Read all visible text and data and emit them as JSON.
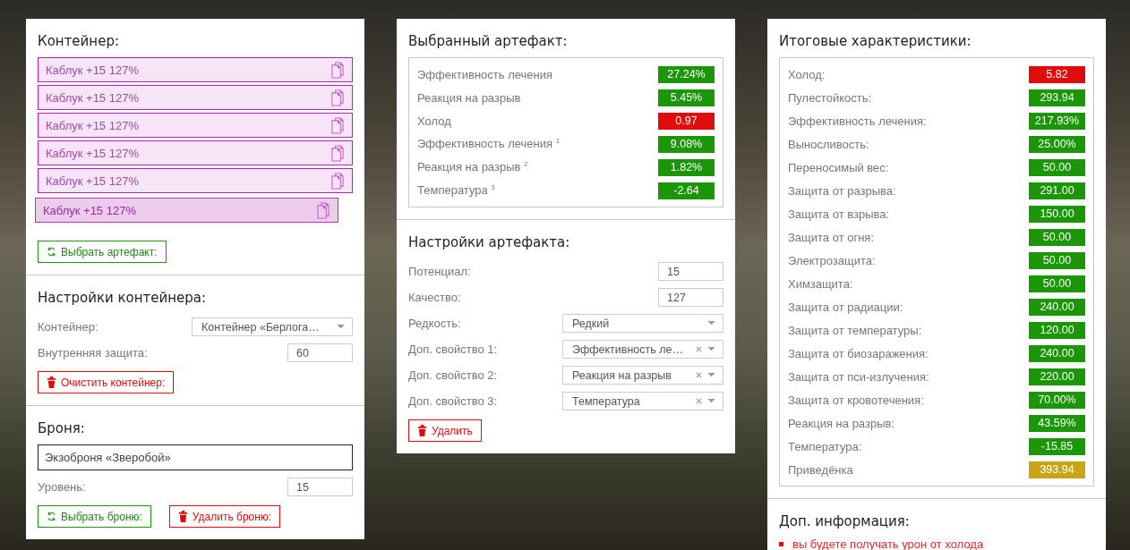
{
  "container": {
    "title": "Контейнер:",
    "items": [
      {
        "label": "Каблук +15 127%",
        "selected": false
      },
      {
        "label": "Каблук +15 127%",
        "selected": false
      },
      {
        "label": "Каблук +15 127%",
        "selected": false
      },
      {
        "label": "Каблук +15 127%",
        "selected": false
      },
      {
        "label": "Каблук +15 127%",
        "selected": false
      },
      {
        "label": "Каблук +15 127%",
        "selected": true
      }
    ],
    "select_button": "Выбрать артефакт:"
  },
  "container_settings": {
    "title": "Настройки контейнера:",
    "fields": [
      {
        "kind": "select",
        "label": "Контейнер:",
        "value": "Контейнер «Берлога…",
        "clearable": false
      },
      {
        "kind": "input",
        "label": "Внутренняя защита:",
        "value": "60"
      }
    ],
    "clear_button": "Очистить контейнер:"
  },
  "armor": {
    "title": "Броня:",
    "name": "Экзоброня «Зверобой»",
    "fields": [
      {
        "kind": "input",
        "label": "Уровень:",
        "value": "15"
      }
    ],
    "select_button": "Выбрать броню:",
    "delete_button": "Удалить броню:"
  },
  "selected_artifact": {
    "title": "Выбранный артефакт:",
    "stats": [
      {
        "label": "Эффективность лечения",
        "value": "27.24%",
        "color": "#1a9606"
      },
      {
        "label": "Реакция на разрыв",
        "value": "5.45%",
        "color": "#1a9606"
      },
      {
        "label": "Холод",
        "value": "0.97",
        "color": "#e00b0b"
      },
      {
        "label": "Эффективность лечения $^{1}$",
        "value": "9.08%",
        "color": "#1a9606"
      },
      {
        "label": "Реакция на разрыв $^{2}$",
        "value": "1.82%",
        "color": "#1a9606"
      },
      {
        "label": "Температура $^{3}$",
        "value": "-2.64",
        "color": "#1a9606"
      }
    ]
  },
  "artifact_settings": {
    "title": "Настройки артефакта:",
    "fields": [
      {
        "kind": "input",
        "label": "Потенциал:",
        "value": "15"
      },
      {
        "kind": "input",
        "label": "Качество:",
        "value": "127"
      },
      {
        "kind": "select",
        "label": "Редкость:",
        "value": "Редкий",
        "clearable": false
      },
      {
        "kind": "select",
        "label": "Доп. свойство 1:",
        "value": "Эффективность ле…",
        "clearable": true
      },
      {
        "kind": "select",
        "label": "Доп. свойство 2:",
        "value": "Реакция на разрыв",
        "clearable": true
      },
      {
        "kind": "select",
        "label": "Доп. свойство 3:",
        "value": "Температура",
        "clearable": true
      }
    ],
    "delete_button": "Удалить"
  },
  "totals": {
    "title": "Итоговые характеристики:",
    "stats": [
      {
        "label": "Холод:",
        "value": "5.82",
        "color": "#e00b0b"
      },
      {
        "label": "Пулестойкость:",
        "value": "293.94",
        "color": "#1a9606"
      },
      {
        "label": "Эффективность лечения:",
        "value": "217.93%",
        "color": "#1a9606"
      },
      {
        "label": "Выносливость:",
        "value": "25.00%",
        "color": "#1a9606"
      },
      {
        "label": "Переносимый вес:",
        "value": "50.00",
        "color": "#1a9606"
      },
      {
        "label": "Защита от разрыва:",
        "value": "291.00",
        "color": "#1a9606"
      },
      {
        "label": "Защита от взрыва:",
        "value": "150.00",
        "color": "#1a9606"
      },
      {
        "label": "Защита от огня:",
        "value": "50.00",
        "color": "#1a9606"
      },
      {
        "label": "Электрозащита:",
        "value": "50.00",
        "color": "#1a9606"
      },
      {
        "label": "Химзащита:",
        "value": "50.00",
        "color": "#1a9606"
      },
      {
        "label": "Защита от радиации:",
        "value": "240.00",
        "color": "#1a9606"
      },
      {
        "label": "Защита от температуры:",
        "value": "120.00",
        "color": "#1a9606"
      },
      {
        "label": "Защита от биозаражения:",
        "value": "240.00",
        "color": "#1a9606"
      },
      {
        "label": "Защита от пси-излучения:",
        "value": "220.00",
        "color": "#1a9606"
      },
      {
        "label": "Защита от кровотечения:",
        "value": "70.00%",
        "color": "#1a9606"
      },
      {
        "label": "Реакция на разрыв:",
        "value": "43.59%",
        "color": "#1a9606"
      },
      {
        "label": "Температура:",
        "value": "-15.85",
        "color": "#1a9606"
      },
      {
        "label": "Приведёнка",
        "value": "393.94",
        "color": "#c9a417"
      }
    ]
  },
  "extra_info": {
    "title": "Доп. информация:",
    "notes": [
      "вы будете получать урон от холода"
    ]
  }
}
